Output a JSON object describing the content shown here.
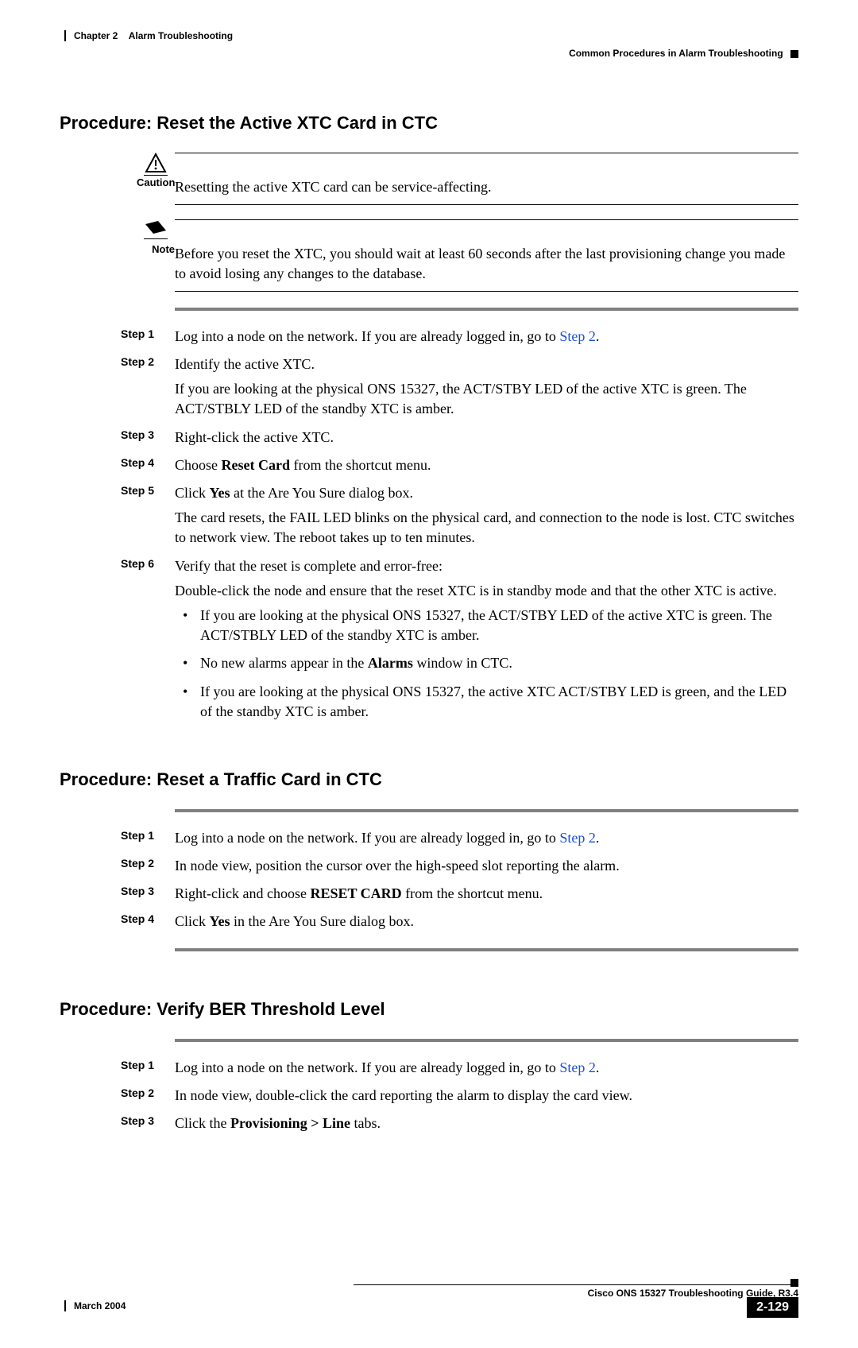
{
  "header": {
    "chapter": "Chapter 2",
    "title": "Alarm Troubleshooting",
    "section": "Common Procedures in Alarm Troubleshooting"
  },
  "procedures": {
    "p1": {
      "heading": "Procedure: Reset the Active XTC Card in CTC",
      "caution_label": "Caution",
      "caution_text": "Resetting the active XTC card can be service-affecting.",
      "note_label": "Note",
      "note_text": "Before you reset the XTC, you should wait at least 60 seconds after the last provisioning change you made to avoid losing any changes to the database.",
      "steps": {
        "s1": {
          "label": "Step 1",
          "text_a": "Log into a node on the network. If you are already logged in, go to ",
          "link": "Step 2",
          "text_b": "."
        },
        "s2": {
          "label": "Step 2",
          "line1": "Identify the active XTC.",
          "line2": "If you are looking at the physical ONS 15327, the ACT/STBY LED of the active XTC is green. The ACT/STBLY LED of the standby XTC is amber."
        },
        "s3": {
          "label": "Step 3",
          "text": "Right-click the active XTC."
        },
        "s4": {
          "label": "Step 4",
          "text_a": "Choose ",
          "bold": "Reset Card",
          "text_b": " from the shortcut menu."
        },
        "s5": {
          "label": "Step 5",
          "text_a": "Click ",
          "bold": "Yes",
          "text_b": " at the Are You Sure dialog box.",
          "line2": "The card resets, the FAIL LED blinks on the physical card, and connection to the node is lost. CTC switches to network view. The reboot takes up to ten minutes."
        },
        "s6": {
          "label": "Step 6",
          "line1": "Verify that the reset is complete and error-free:",
          "line2": "Double-click the node and ensure that the reset XTC is in standby mode and that the other XTC is active.",
          "b1": "If you are looking at the physical ONS 15327, the ACT/STBY LED of the active XTC is green. The ACT/STBLY LED of the standby XTC is amber.",
          "b2_a": "No new alarms appear in the ",
          "b2_bold": "Alarms",
          "b2_b": " window in CTC.",
          "b3": "If you are looking at the physical ONS 15327, the active XTC ACT/STBY LED is green, and the LED of the standby XTC is amber."
        }
      }
    },
    "p2": {
      "heading": "Procedure: Reset a Traffic Card in CTC",
      "steps": {
        "s1": {
          "label": "Step 1",
          "text_a": "Log into a node on the network. If you are already logged in, go to ",
          "link": "Step 2",
          "text_b": "."
        },
        "s2": {
          "label": "Step 2",
          "text": "In node view, position the cursor over the high-speed slot reporting the alarm."
        },
        "s3": {
          "label": "Step 3",
          "text_a": "Right-click and choose ",
          "bold": "RESET CARD",
          "text_b": " from the shortcut menu."
        },
        "s4": {
          "label": "Step 4",
          "text_a": "Click ",
          "bold": "Yes",
          "text_b": " in the Are You Sure dialog box."
        }
      }
    },
    "p3": {
      "heading": "Procedure: Verify BER Threshold Level",
      "steps": {
        "s1": {
          "label": "Step 1",
          "text_a": "Log into a node on the network. If you are already logged in, go to ",
          "link": "Step 2",
          "text_b": "."
        },
        "s2": {
          "label": "Step 2",
          "text": "In node view, double-click the card reporting the alarm to display the card view."
        },
        "s3": {
          "label": "Step 3",
          "text_a": "Click the ",
          "bold": "Provisioning > Line",
          "text_b": " tabs."
        }
      }
    }
  },
  "footer": {
    "doc_title": "Cisco ONS 15327 Troubleshooting Guide, R3.4",
    "date": "March 2004",
    "page_number": "2-129"
  }
}
